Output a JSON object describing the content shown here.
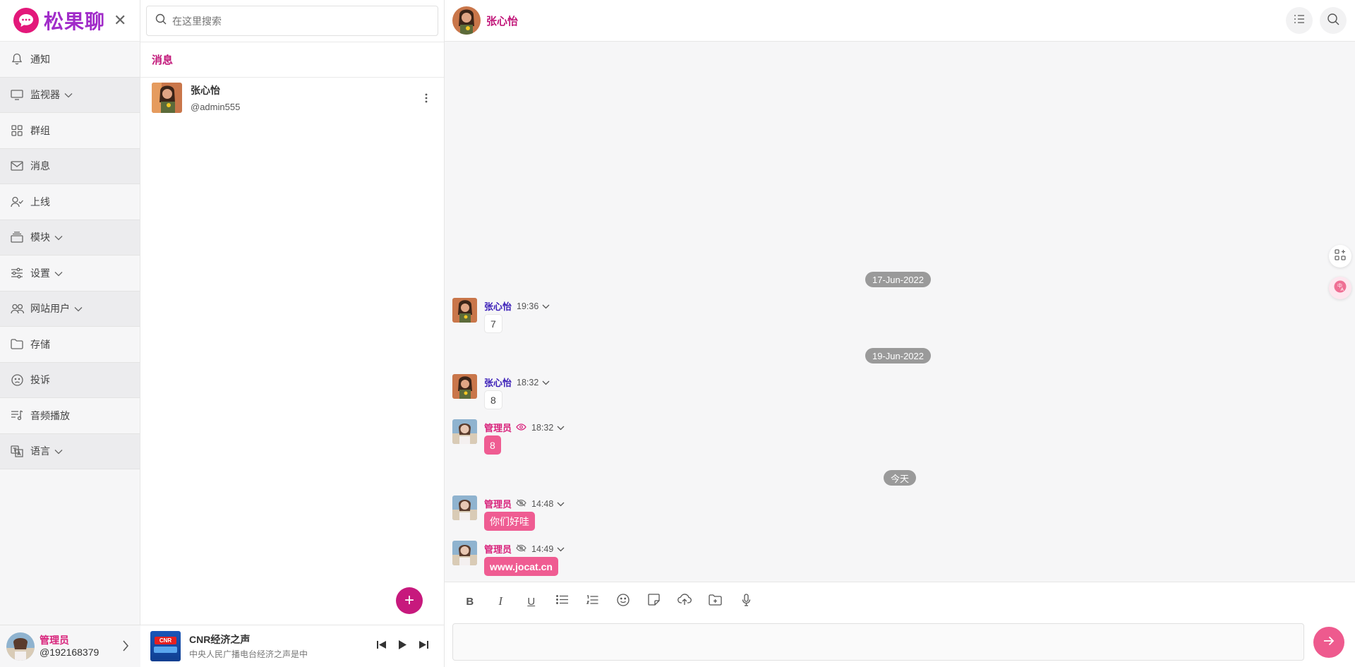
{
  "app": {
    "name": "松果聊",
    "brand_color": "#a12cc9",
    "accent": "#c7197d"
  },
  "sidebar": {
    "items": [
      {
        "label": "通知",
        "icon": "bell-icon",
        "has_submenu": false
      },
      {
        "label": "监视器",
        "icon": "monitor-icon",
        "has_submenu": true
      },
      {
        "label": "群组",
        "icon": "grid-icon",
        "has_submenu": false
      },
      {
        "label": "消息",
        "icon": "mail-icon",
        "has_submenu": false
      },
      {
        "label": "上线",
        "icon": "user-check-icon",
        "has_submenu": false
      },
      {
        "label": "模块",
        "icon": "layers-icon",
        "has_submenu": true
      },
      {
        "label": "设置",
        "icon": "sliders-icon",
        "has_submenu": true
      },
      {
        "label": "网站用户",
        "icon": "users-icon",
        "has_submenu": true
      },
      {
        "label": "存储",
        "icon": "folder-icon",
        "has_submenu": false
      },
      {
        "label": "投诉",
        "icon": "sad-face-icon",
        "has_submenu": false
      },
      {
        "label": "音频播放",
        "icon": "playlist-icon",
        "has_submenu": false
      },
      {
        "label": "语言",
        "icon": "translate-icon",
        "has_submenu": true
      }
    ],
    "user": {
      "name": "管理员",
      "handle": "@192168379"
    }
  },
  "list": {
    "search_placeholder": "在这里搜索",
    "header": "消息",
    "conversations": [
      {
        "name": "张心怡",
        "handle": "@admin555"
      }
    ]
  },
  "player": {
    "cover_text": "CNR",
    "title": "CNR经济之声",
    "subtitle": "中央人民广播电台经济之声是中"
  },
  "chat": {
    "contact_name": "张心怡",
    "dates": [
      "17-Jun-2022",
      "19-Jun-2022",
      "今天"
    ],
    "messages": [
      {
        "sender": "张心怡",
        "time": "19:36",
        "text": "7",
        "outgoing": false,
        "seen": null
      },
      {
        "sender": "张心怡",
        "time": "18:32",
        "text": "8",
        "outgoing": false,
        "seen": null
      },
      {
        "sender": "管理员",
        "time": "18:32",
        "text": "8",
        "outgoing": true,
        "seen": true
      },
      {
        "sender": "管理员",
        "time": "14:48",
        "text": "你们好哇",
        "outgoing": true,
        "seen": false
      },
      {
        "sender": "管理员",
        "time": "14:49",
        "text": "www.jocat.cn",
        "outgoing": true,
        "seen": false
      }
    ],
    "colors": {
      "incoming_name": "#3b1fb8",
      "outgoing_name": "#d8227b",
      "outgoing_bubble": "#ef5c92"
    }
  },
  "composer": {
    "tools": [
      "bold-icon",
      "italic-icon",
      "underline-icon",
      "bullet-list-icon",
      "numbered-list-icon",
      "emoji-icon",
      "sticker-icon",
      "upload-cloud-icon",
      "folder-plus-icon",
      "microphone-icon"
    ]
  }
}
